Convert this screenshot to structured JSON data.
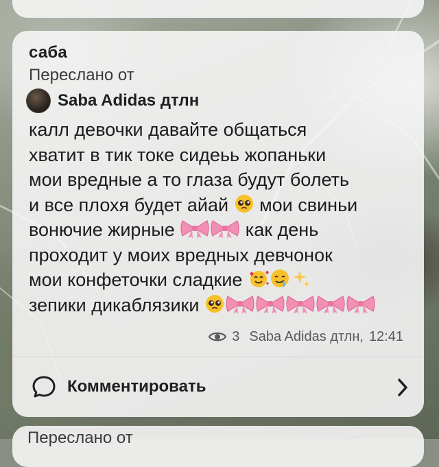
{
  "post": {
    "sender": "саба",
    "forwarded_label": "Переслано от",
    "forward_source": "Saba Adidas дтлн",
    "message_lines": [
      [
        "калл девочки давайте общаться"
      ],
      [
        "хватит в тик токе сидеьь жопаньки"
      ],
      [
        "мои вредные а то глаза будут болеть"
      ],
      [
        "и все плохя будет айай ",
        "{pleading}",
        " мои свиньи"
      ],
      [
        "вонючие жирные ",
        "{bow}{bow}",
        " как день"
      ],
      [
        "проходит у моих вредных девчонок"
      ],
      [
        "мои конфеточки сладкие ",
        "{smiling_hearts}{drooling}{sparkles}"
      ],
      [
        "зепики дикаблязики ",
        "{pleading}{bow}{bow}{bow}{bow}{bow}"
      ]
    ],
    "emoji_names": {
      "pleading": "pleading-face-emoji",
      "bow": "pink-bow-emoji",
      "smiling_hearts": "smiling-face-with-hearts-emoji",
      "drooling": "drooling-face-emoji",
      "sparkles": "sparkles-emoji"
    },
    "views": "3",
    "signature": "Saba Adidas дтлн,",
    "time": "12:41",
    "comment_label": "Комментировать"
  },
  "next_post": {
    "forwarded_label": "Переслано от"
  },
  "colors": {
    "bubble": "#f5f5f5",
    "text": "#1c1c1c",
    "meta": "#5a5a5a",
    "bow_pink": "#f28fb4",
    "emoji_yellow": "#f7c02b"
  }
}
